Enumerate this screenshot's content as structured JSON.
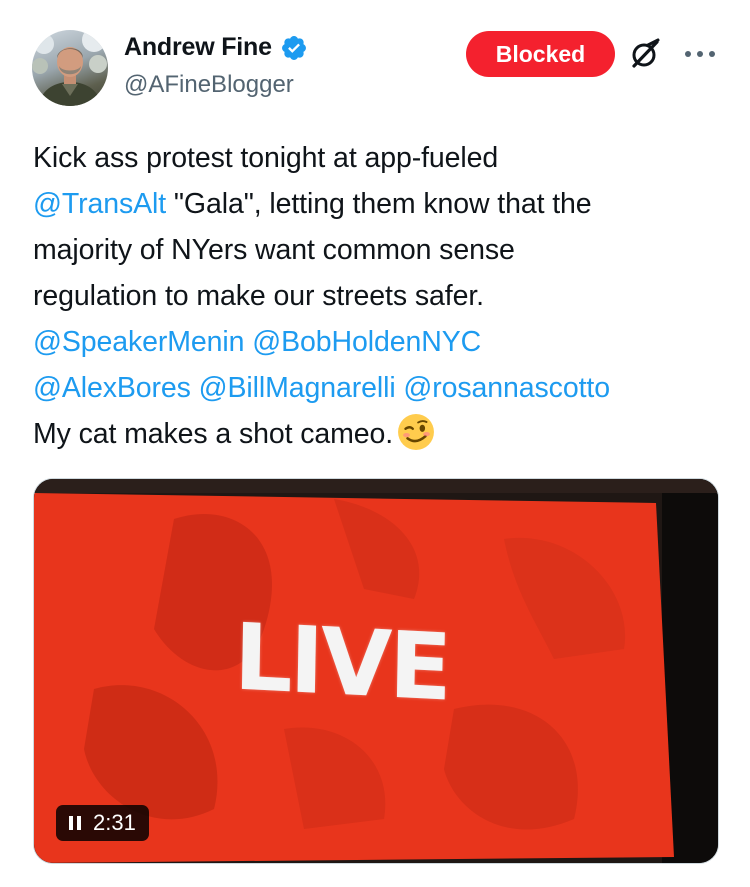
{
  "author": {
    "display_name": "Andrew Fine",
    "handle": "@AFineBlogger",
    "avatar_icon": "profile-photo",
    "verified_icon": "verified-badge-icon",
    "verified_color": "#1d9bf0"
  },
  "header": {
    "blocked_label": "Blocked",
    "blocked_color": "#f4212e",
    "grok_icon": "grok-icon",
    "more_icon": "more-dots-icon"
  },
  "tweet": {
    "line1": {
      "text": "Kick ass protest tonight at app-fueled"
    },
    "line2": {
      "mention": "@TransAlt",
      "text": " \"Gala\", letting them know that the"
    },
    "line3": {
      "text": "majority of NYers want common sense"
    },
    "line4": {
      "text": "regulation to make our streets safer."
    },
    "line5": {
      "mention1": "@SpeakerMenin",
      "mention2": "@BobHoldenNYC"
    },
    "line6": {
      "mention1": "@AlexBores",
      "mention2": "@BillMagnarelli",
      "mention3": "@rosannascotto"
    },
    "line7": {
      "text": "My cat makes a shot cameo.",
      "emoji": "winking-face-emoji"
    },
    "mention_color": "#1d9bf0"
  },
  "media": {
    "screen_text": "LIVE",
    "duration": "2:31",
    "pause_icon": "pause-icon",
    "screen_color": "#e8351c"
  }
}
